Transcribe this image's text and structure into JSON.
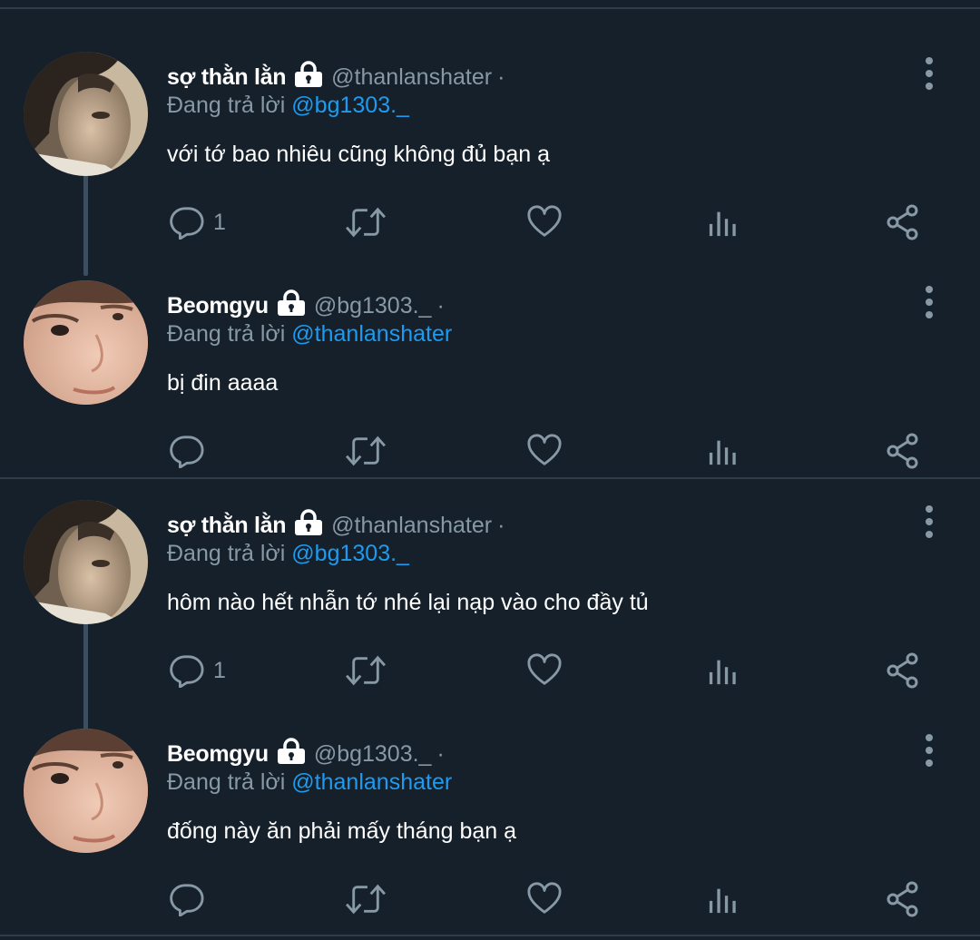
{
  "icons": {
    "lock": "lock-icon",
    "more": "more-vertical-icon",
    "reply": "reply-bubble-icon",
    "retweet": "retweet-icon",
    "like": "heart-icon",
    "analytics": "bar-chart-icon",
    "share": "share-icon"
  },
  "colors": {
    "background": "#15202b",
    "divider": "#2f3d4b",
    "secondary_text": "#8899a6",
    "mention": "#1d9bf0",
    "primary_text": "#ffffff"
  },
  "threads": [
    {
      "tweets": [
        {
          "display_name": "sợ thằn lằn",
          "handle": "@thanlanshater",
          "separator": "·",
          "reply_prefix": "Đang trả lời",
          "reply_to": "@bg1303._",
          "text": "với tớ bao nhiêu cũng không đủ bạn ạ",
          "reply_count": "1"
        },
        {
          "display_name": "Beomgyu",
          "handle": "@bg1303._",
          "separator": "·",
          "reply_prefix": "Đang trả lời",
          "reply_to": "@thanlanshater",
          "text": "bị đin aaaa",
          "reply_count": ""
        }
      ]
    },
    {
      "tweets": [
        {
          "display_name": "sợ thằn lằn",
          "handle": "@thanlanshater",
          "separator": "·",
          "reply_prefix": "Đang trả lời",
          "reply_to": "@bg1303._",
          "text": "hôm nào hết nhẫn tớ nhé lại nạp vào cho đầy tủ",
          "reply_count": "1"
        },
        {
          "display_name": "Beomgyu",
          "handle": "@bg1303._",
          "separator": "·",
          "reply_prefix": "Đang trả lời",
          "reply_to": "@thanlanshater",
          "text": "đống này ăn phải mấy tháng bạn ạ",
          "reply_count": ""
        }
      ]
    }
  ]
}
